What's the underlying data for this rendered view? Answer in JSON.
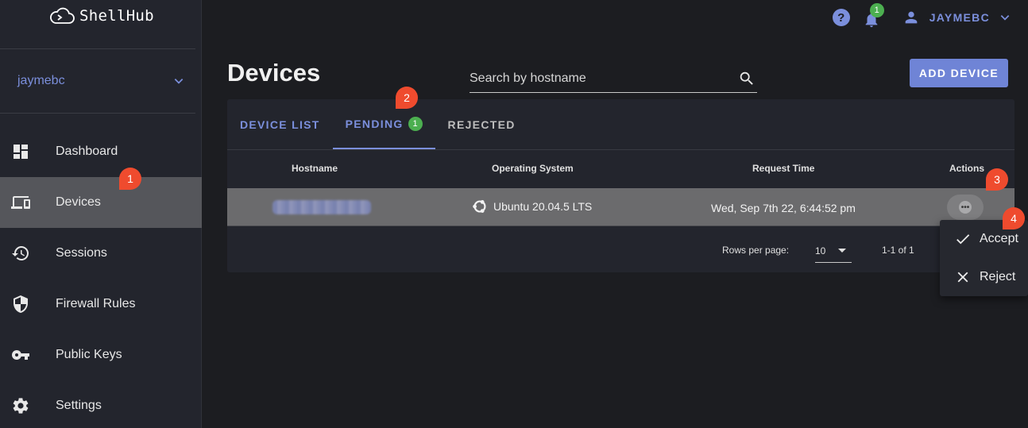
{
  "app": {
    "name": "ShellHub"
  },
  "sidebar": {
    "namespace": "jaymebc",
    "items": [
      {
        "label": "Dashboard",
        "icon": "dashboard-icon"
      },
      {
        "label": "Devices",
        "icon": "devices-icon",
        "active": true
      },
      {
        "label": "Sessions",
        "icon": "history-icon"
      },
      {
        "label": "Firewall Rules",
        "icon": "shield-icon"
      },
      {
        "label": "Public Keys",
        "icon": "key-icon"
      },
      {
        "label": "Settings",
        "icon": "gear-icon"
      }
    ]
  },
  "topbar": {
    "notification_count": "1",
    "username": "JAYMEBC"
  },
  "page": {
    "title": "Devices",
    "search_placeholder": "Search by hostname",
    "add_button": "ADD DEVICE"
  },
  "tabs": [
    {
      "label": "DEVICE LIST"
    },
    {
      "label": "PENDING",
      "badge": "1",
      "active": true
    },
    {
      "label": "REJECTED"
    }
  ],
  "table": {
    "headers": {
      "hostname": "Hostname",
      "os": "Operating System",
      "request_time": "Request Time",
      "actions": "Actions"
    },
    "rows": [
      {
        "os": "Ubuntu 20.04.5 LTS",
        "request_time": "Wed, Sep 7th 22, 6:44:52 pm"
      }
    ],
    "footer": {
      "rows_per_page_label": "Rows per page:",
      "rows_per_page": "10",
      "range": "1-1 of 1"
    }
  },
  "menu": {
    "accept": "Accept",
    "reject": "Reject"
  },
  "markers": [
    "1",
    "2",
    "3",
    "4"
  ],
  "colors": {
    "accent": "#7b8fdc",
    "badge": "#4caf50",
    "marker": "#ef4b2e",
    "active_row": "#6b6b6d"
  }
}
